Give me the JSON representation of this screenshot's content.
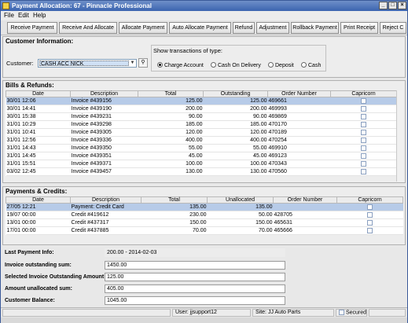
{
  "window": {
    "title": "Payment Allocation: 67 - Pinnacle Professional"
  },
  "menu": [
    "File",
    "Edit",
    "Help"
  ],
  "toolbar": [
    "Receive Payment",
    "Receive And Allocate",
    "Allocate Payment",
    "Auto Allocate Payment",
    "Refund",
    "Adjustment",
    "Rollback Payment",
    "Print Receipt",
    "Reject C"
  ],
  "customer": {
    "section_title": "Customer Information:",
    "label": "Customer:",
    "value": "CASH ACC NICK",
    "types_title": "Show transactions of type:",
    "types": [
      "Charge Account",
      "Cash On Delivery",
      "Deposit",
      "Cash"
    ],
    "selected_type": "Charge Account"
  },
  "bills": {
    "title": "Bills & Refunds:",
    "columns": [
      "Date",
      "Description",
      "Total",
      "Outstanding",
      "Order Number",
      "Capricorn"
    ],
    "rows": [
      [
        "30/01 12:06",
        "Invoice #439156",
        "125.00",
        "125.00",
        "469661"
      ],
      [
        "30/01 14:41",
        "Invoice #439190",
        "200.00",
        "200.00",
        "469993"
      ],
      [
        "30/01 15:38",
        "Invoice #439231",
        "90.00",
        "90.00",
        "469869"
      ],
      [
        "31/01 10:29",
        "Invoice #439298",
        "185.00",
        "185.00",
        "470170"
      ],
      [
        "31/01 10:41",
        "Invoice #439305",
        "120.00",
        "120.00",
        "470189"
      ],
      [
        "31/01 12:56",
        "Invoice #439336",
        "400.00",
        "400.00",
        "470254"
      ],
      [
        "31/01 14:43",
        "Invoice #439350",
        "55.00",
        "55.00",
        "469910"
      ],
      [
        "31/01 14:45",
        "Invoice #439351",
        "45.00",
        "45.00",
        "469123"
      ],
      [
        "31/01 15:51",
        "Invoice #439371",
        "100.00",
        "100.00",
        "470343"
      ],
      [
        "03/02 12:45",
        "Invoice #439457",
        "130.00",
        "130.00",
        "470560"
      ]
    ]
  },
  "payments": {
    "title": "Payments & Credits:",
    "columns": [
      "Date",
      "Description",
      "Total",
      "Unallocated",
      "Order Number",
      "Capricorn"
    ],
    "rows": [
      [
        "27/05 12:21",
        "Payment: Credit Card",
        "135.00",
        "135.00",
        ""
      ],
      [
        "19/07 00:00",
        "Credit #419612",
        "230.00",
        "50.00",
        "428705"
      ],
      [
        "13/01 00:00",
        "Credit #437317",
        "150.00",
        "150.00",
        "465631"
      ],
      [
        "17/01 00:00",
        "Credit #437885",
        "70.00",
        "70.00",
        "465666"
      ]
    ]
  },
  "summary": {
    "last_payment_label": "Last Payment Info:",
    "last_payment_value": "200.00 - 2014-02-03",
    "invoice_outstanding_label": "Invoice outstanding sum:",
    "invoice_outstanding_value": "1450.00",
    "selected_outstanding_label": "Selected Invoice Outstanding Amount",
    "selected_outstanding_value": "125.00",
    "amount_unallocated_label": "Amount unallocated sum:",
    "amount_unallocated_value": "405.00",
    "customer_balance_label": "Customer Balance:",
    "customer_balance_value": "1045.00"
  },
  "status": {
    "user": "User: jjsupport12",
    "site": "Site: JJ Auto Parts",
    "secured": "Secured"
  }
}
